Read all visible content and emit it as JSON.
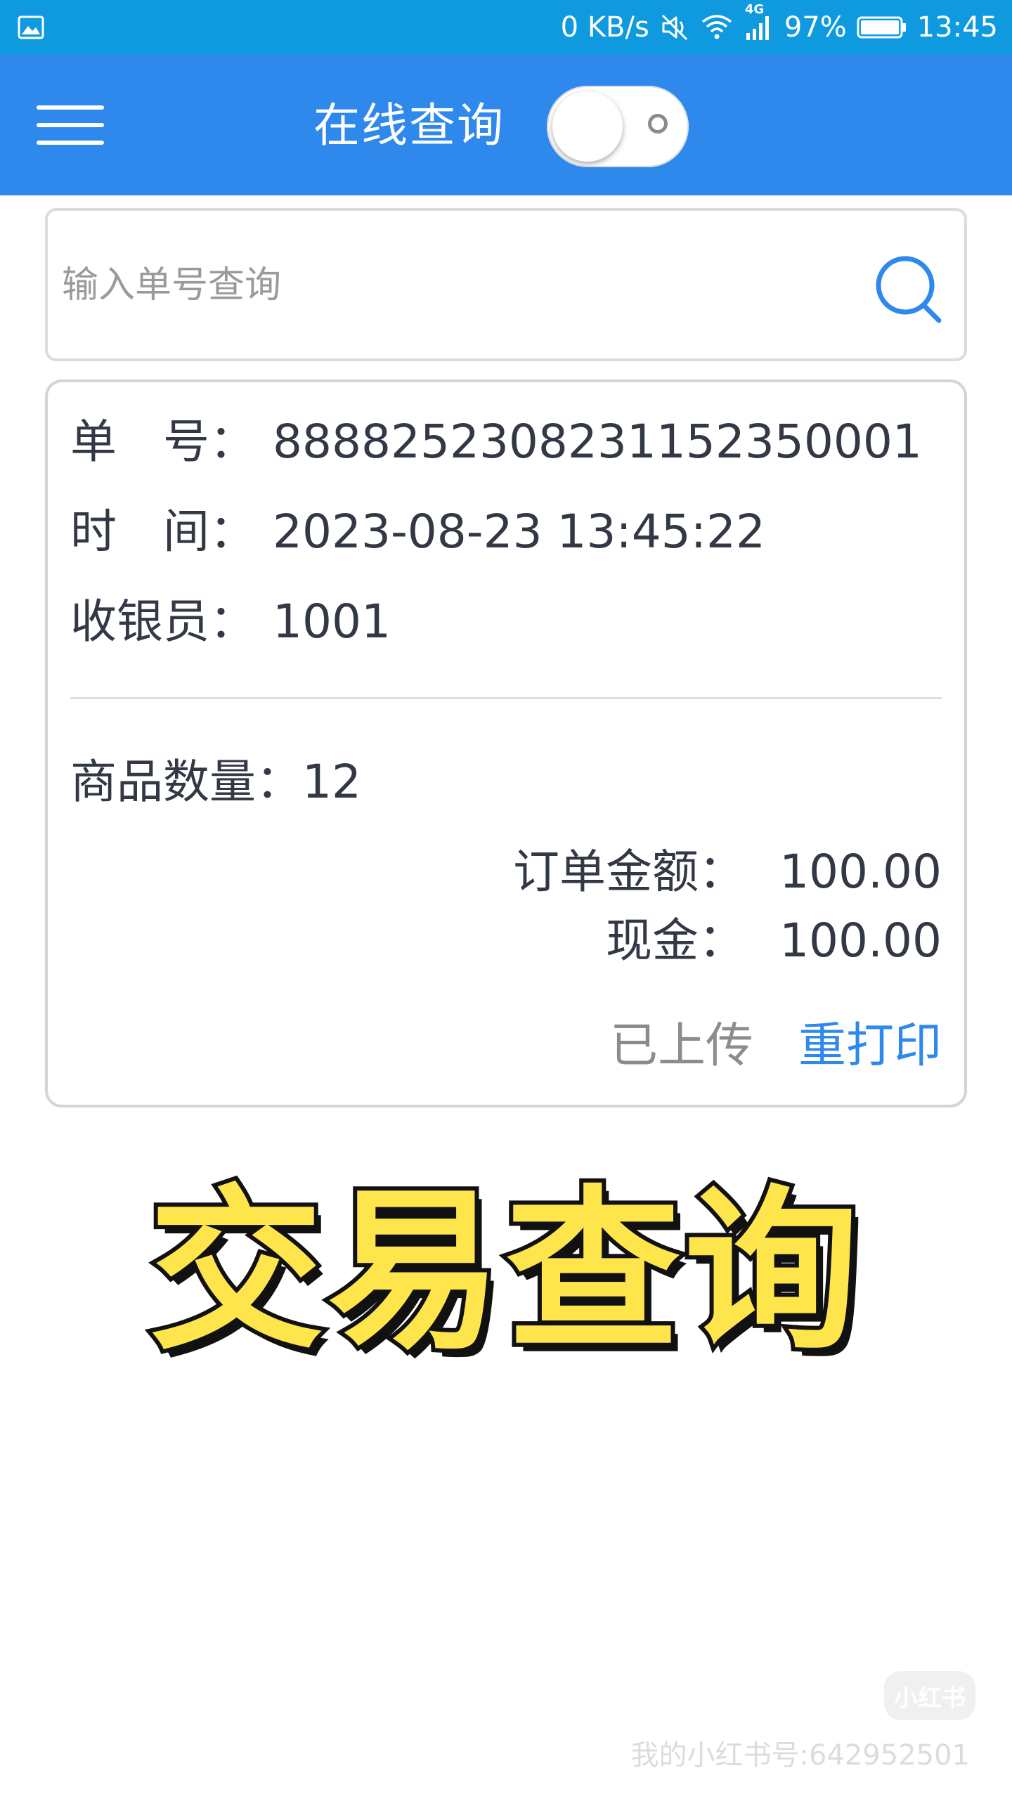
{
  "status_bar": {
    "network_speed": "0 KB/s",
    "network_type": "4G",
    "battery": "97%",
    "time": "13:45"
  },
  "app_bar": {
    "title": "在线查询",
    "online_toggle_on": false
  },
  "search": {
    "placeholder": "输入单号查询",
    "value": ""
  },
  "record": {
    "order_no_label": "单　号：",
    "order_no": "8888252308231152350001",
    "time_label": "时　间：",
    "time": "2023-08-23 13:45:22",
    "cashier_label": "收银员：",
    "cashier": "1001",
    "item_count_label": "商品数量：",
    "item_count": "12",
    "order_amount_label": "订单金额：",
    "order_amount": "100.00",
    "cash_label": "现金：",
    "cash": "100.00",
    "upload_status": "已上传",
    "reprint_label": "重打印"
  },
  "caption": "交易查询",
  "watermark": {
    "badge": "小红书",
    "text": "我的小红书号:642952501"
  },
  "colors": {
    "status_bar": "#0f9ae0",
    "app_bar": "#2f88ec",
    "accent": "#2f88ec",
    "caption_fill": "#ffe54c"
  },
  "icons": [
    "gallery-icon",
    "mute-icon",
    "wifi-icon",
    "signal-icon",
    "battery-icon",
    "menu-icon",
    "search-icon"
  ]
}
